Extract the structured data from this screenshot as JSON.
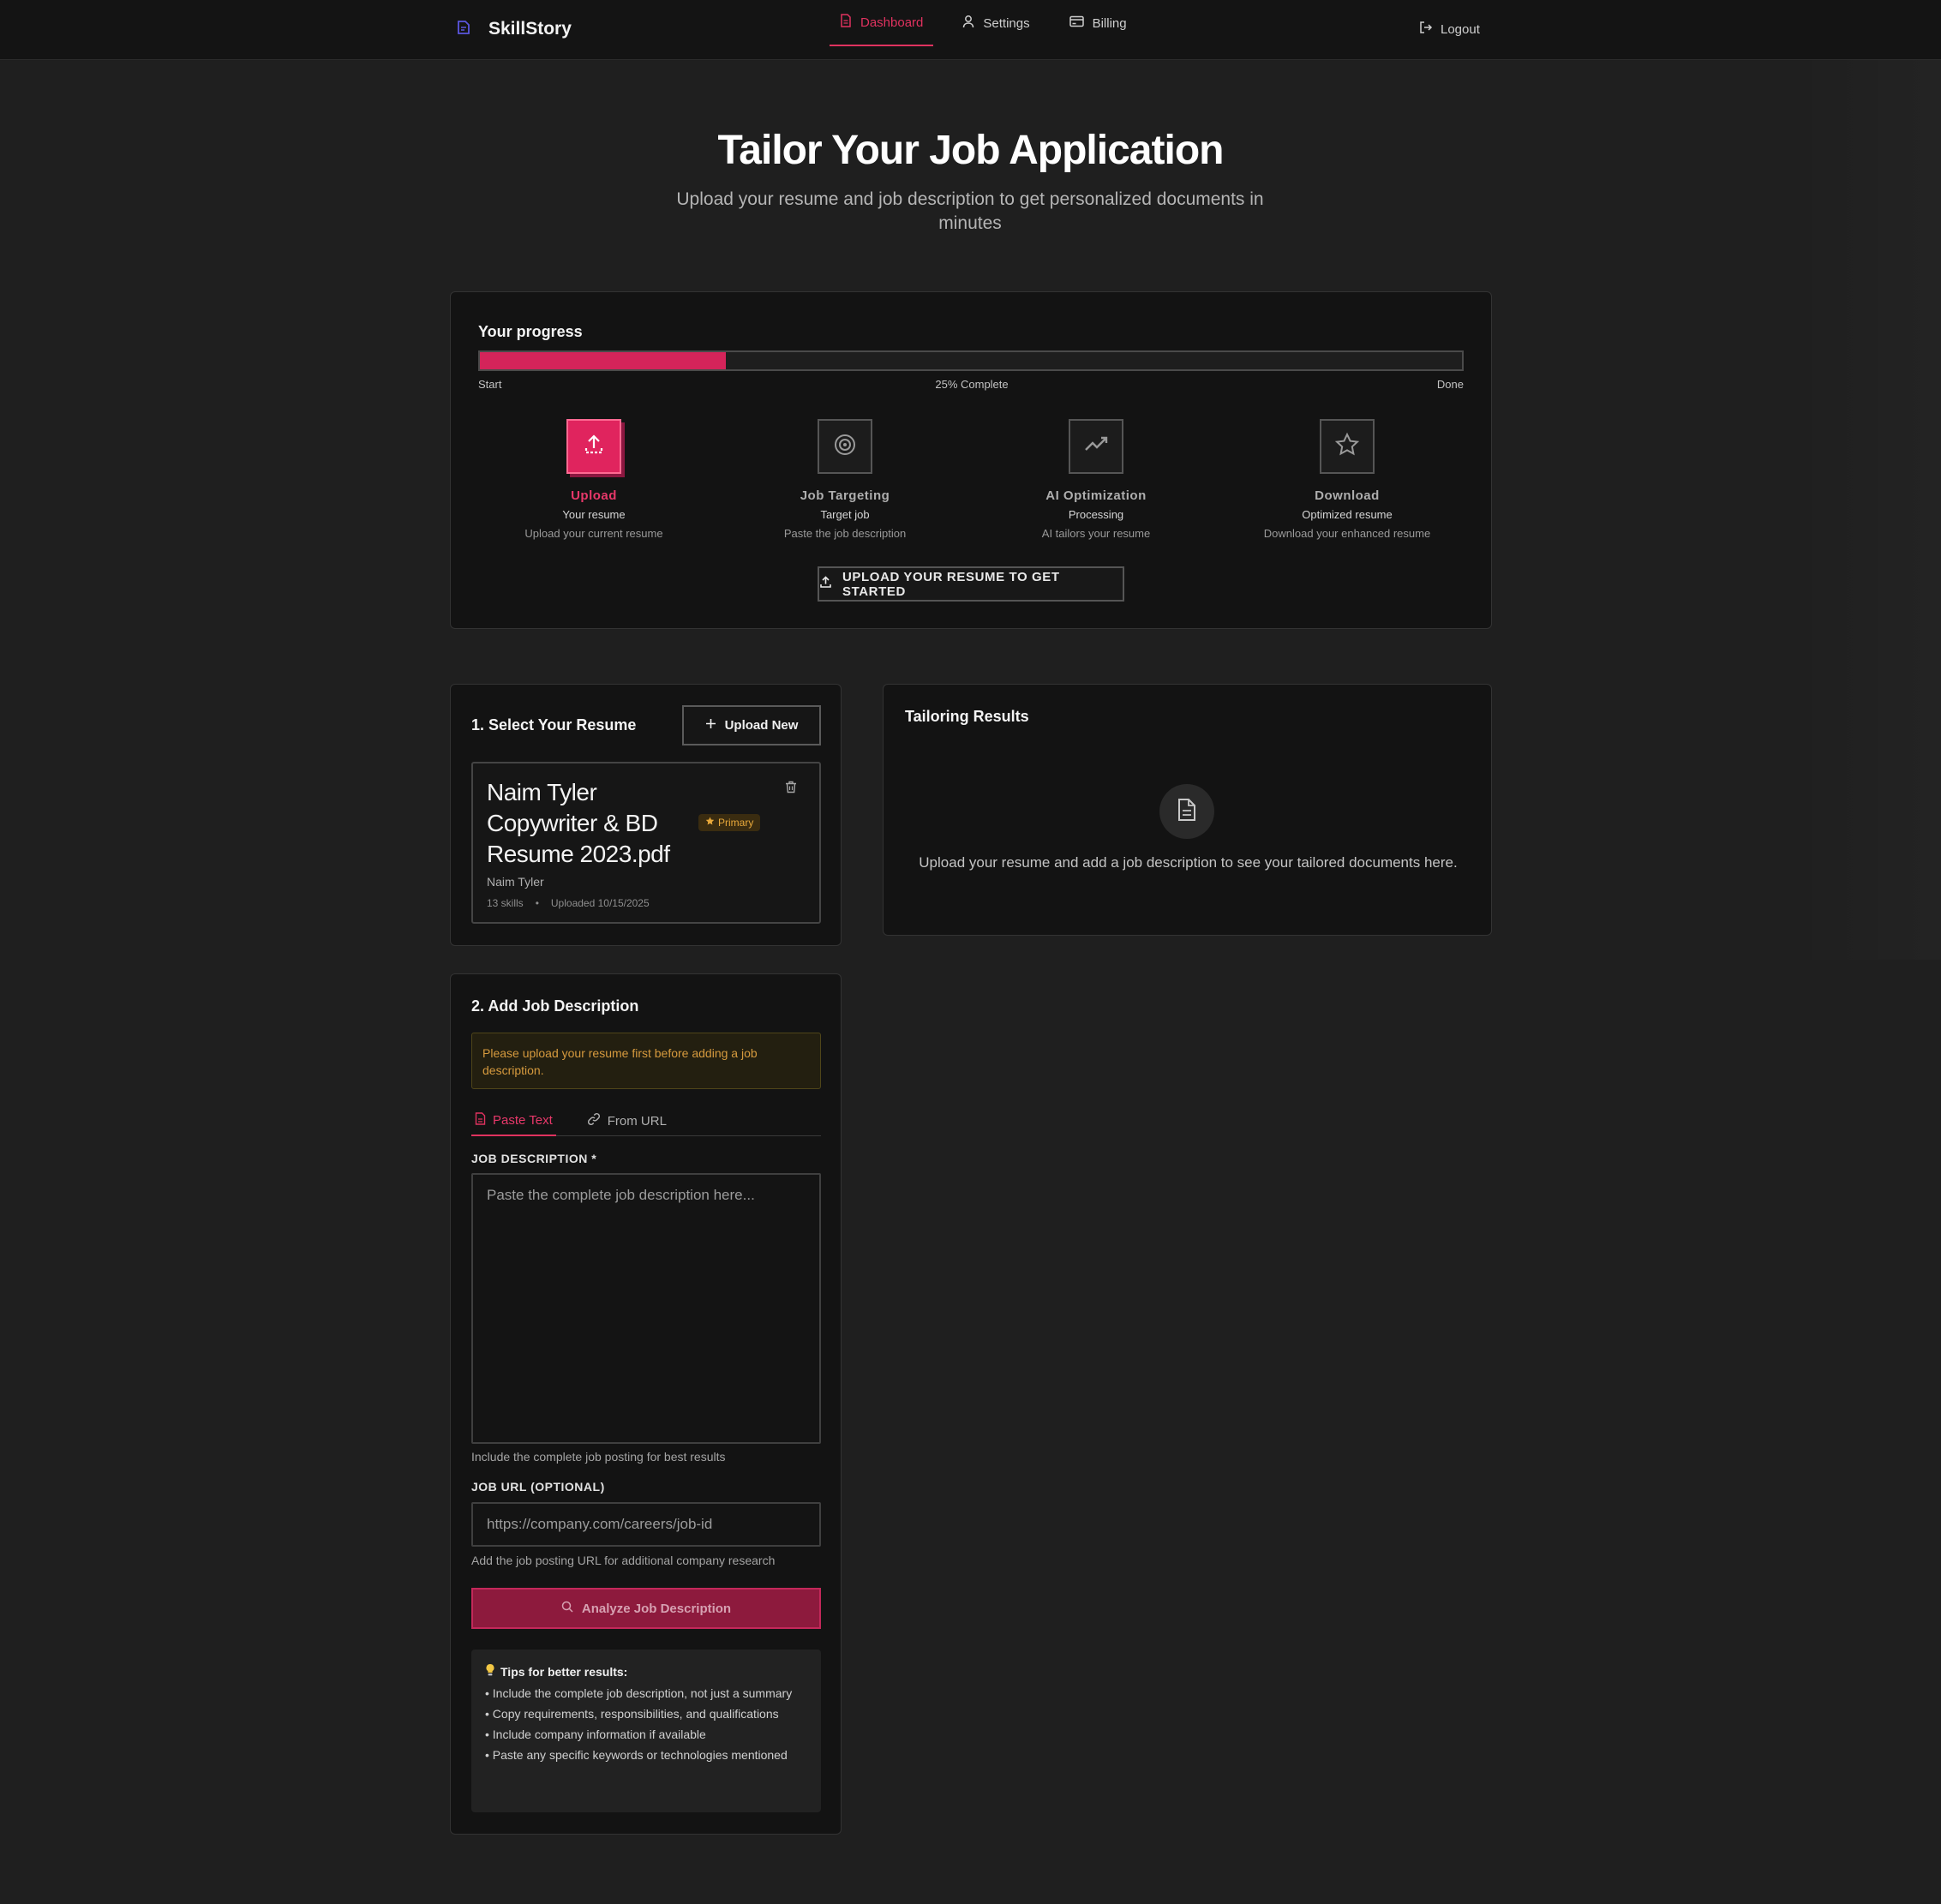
{
  "nav": {
    "brand": "SkillStory",
    "tabs": [
      {
        "label": "Dashboard",
        "icon": "document-icon"
      },
      {
        "label": "Settings",
        "icon": "user-icon"
      },
      {
        "label": "Billing",
        "icon": "credit-card-icon"
      }
    ],
    "logout": "Logout"
  },
  "hero": {
    "title": "Tailor Your Job Application",
    "subtitle": "Upload your resume and job description to get personalized documents in minutes"
  },
  "progress": {
    "title": "Your progress",
    "percent": 25,
    "start_label": "Start",
    "complete_label": "25% Complete",
    "done_label": "Done",
    "steps": [
      {
        "name": "Upload",
        "sub": "Your resume",
        "desc": "Upload your current resume",
        "icon": "upload-icon"
      },
      {
        "name": "Job Targeting",
        "sub": "Target job",
        "desc": "Paste the job description",
        "icon": "target-icon"
      },
      {
        "name": "AI Optimization",
        "sub": "Processing",
        "desc": "AI tailors your resume",
        "icon": "trend-icon"
      },
      {
        "name": "Download",
        "sub": "Optimized resume",
        "desc": "Download your enhanced resume",
        "icon": "star-icon"
      }
    ],
    "cta": "UPLOAD YOUR RESUME TO GET STARTED"
  },
  "resume": {
    "title": "1. Select Your Resume",
    "upload_new": "Upload New",
    "item": {
      "name": "Naim Tyler Copywriter & BD Resume 2023.pdf",
      "badge": "Primary",
      "owner": "Naim Tyler",
      "skills": "13 skills",
      "separator": "•",
      "uploaded": "Uploaded 10/15/2025"
    }
  },
  "results": {
    "title": "Tailoring Results",
    "message": "Upload your resume and add a job description to see your tailored documents here."
  },
  "job": {
    "title": "2. Add Job Description",
    "warning": "Please upload your resume first before adding a job description.",
    "tabs": [
      {
        "label": "Paste Text",
        "icon": "document-icon"
      },
      {
        "label": "From URL",
        "icon": "link-icon"
      }
    ],
    "description_label": "JOB DESCRIPTION *",
    "description_placeholder": "Paste the complete job description here...",
    "description_help": "Include the complete job posting for best results",
    "url_label": "JOB URL (OPTIONAL)",
    "url_placeholder": "https://company.com/careers/job-id",
    "url_help": "Add the job posting URL for additional company research",
    "analyze": "Analyze Job Description",
    "tips_title": "Tips for better results:",
    "tips": [
      "• Include the complete job description, not just a summary",
      "• Copy requirements, responsibilities, and qualifications",
      "• Include company information if available",
      "• Paste any specific keywords or technologies mentioned"
    ]
  },
  "colors": {
    "accent": "#e0325f",
    "background": "#1f1f1f",
    "card": "#131313",
    "warning": "#d69a3e"
  }
}
